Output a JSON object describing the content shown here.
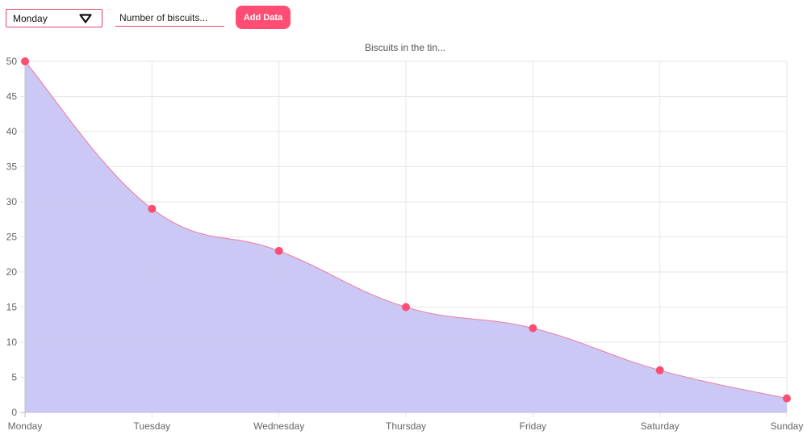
{
  "controls": {
    "day_select": {
      "selected": "Monday",
      "arrow_icon": "triangle-down-icon"
    },
    "biscuits_input": {
      "value": "",
      "placeholder": "Number of biscuits..."
    },
    "add_button_label": "Add Data"
  },
  "colors": {
    "accent": "#ff4d73",
    "fill": "#c9c5f4",
    "line": "#f07aa0",
    "point": "#ff4d73",
    "grid": "#e6e6e6"
  },
  "chart_data": {
    "type": "area",
    "title": "Biscuits in the tin...",
    "categories": [
      "Monday",
      "Tuesday",
      "Wednesday",
      "Thursday",
      "Friday",
      "Saturday",
      "Sunday"
    ],
    "values": [
      50,
      29,
      23,
      15,
      12,
      6,
      2
    ],
    "ylim": [
      0,
      50
    ],
    "yticks": [
      0,
      5,
      10,
      15,
      20,
      25,
      30,
      35,
      40,
      45,
      50
    ],
    "xlabel": "",
    "ylabel": "",
    "grid": true,
    "legend": "none",
    "smooth": true
  }
}
